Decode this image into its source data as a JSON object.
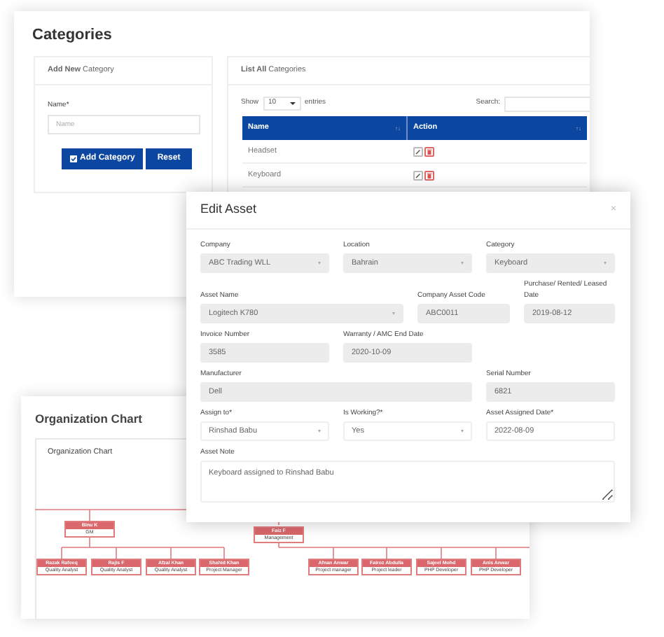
{
  "categories_window": {
    "title": "Categories",
    "add_panel": {
      "heading": "**Add New** Category",
      "name_label": "Name*",
      "name_placeholder": "Name",
      "buttons": [
        "Add Category",
        "Reset"
      ]
    },
    "list_panel": {
      "heading": "**List All** Categories",
      "show_label": "Show",
      "page_size": "10",
      "entries_label": "entries",
      "search_label": "Search:",
      "columns": [
        {
          "label": "Name",
          "sort_icon": "↑↓"
        },
        {
          "label": "Action",
          "sort_icon": "↑↓"
        }
      ],
      "rows": [
        {
          "name": "Headset"
        },
        {
          "name": "Keyboard"
        }
      ]
    }
  },
  "org_window": {
    "title": "Organization Chart",
    "panel_heading": "Organization Chart",
    "nodes": [
      {
        "name": "Binu K",
        "role": "GM",
        "children": [
          {
            "name": "Razak Rafeeq",
            "role": "Quality Analyst"
          },
          {
            "name": "Rajis F",
            "role": "Quality Analyst"
          },
          {
            "name": "Afzal Khan",
            "role": "Quality Analyst"
          },
          {
            "name": "Shahid Khan",
            "role": "Project Manager"
          }
        ]
      },
      {
        "name": "Faiz F",
        "role": "Management",
        "children": [
          {
            "name": "Afnan Anwar",
            "role": "Project manager"
          },
          {
            "name": "Fairoz Abdulla",
            "role": "Project leader"
          },
          {
            "name": "Sajeel Mohd",
            "role": "PHP Developer"
          },
          {
            "name": "Anis Anwar",
            "role": "PHP Developer"
          }
        ]
      }
    ]
  },
  "edit_asset": {
    "title": "Edit Asset",
    "close": "×",
    "rows": [
      [
        {
          "label": "Company",
          "value": "ABC Trading WLL",
          "kind": "select",
          "disabled": true
        },
        {
          "label": "Location",
          "value": "Bahrain",
          "kind": "select",
          "disabled": true
        },
        {
          "label": "Category",
          "value": "Keyboard",
          "kind": "select",
          "disabled": true
        }
      ],
      [
        {
          "label": "Asset Name",
          "value": "Logitech K780",
          "kind": "select",
          "disabled": true
        },
        {
          "label": "Company Asset Code",
          "value": "ABC0011",
          "kind": "text",
          "disabled": true
        },
        {
          "label": "Purchase/ Rented/ Leased Date",
          "value": "2019-08-12",
          "kind": "text",
          "disabled": true
        }
      ],
      [
        {
          "label": "Invoice Number",
          "value": "3585",
          "kind": "text",
          "disabled": true
        },
        {
          "label": "Warranty / AMC End Date",
          "value": "2020-10-09",
          "kind": "text",
          "disabled": true
        }
      ],
      [
        {
          "label": "Manufacturer",
          "value": "Dell",
          "kind": "text",
          "disabled": true
        },
        "",
        {
          "label": "Serial Number",
          "value": "6821",
          "kind": "text",
          "disabled": true
        }
      ],
      [
        {
          "label": "Assign to*",
          "value": "Rinshad Babu",
          "kind": "select",
          "disabled": false
        },
        {
          "label": "Is Working?*",
          "value": "Yes",
          "kind": "select",
          "disabled": false
        },
        {
          "label": "Asset Assigned Date*",
          "value": "2022-08-09",
          "kind": "text",
          "disabled": false
        }
      ],
      [
        {
          "label": "Asset Note",
          "value": "Keyboard assigned to Rinshad Babu",
          "kind": "textarea",
          "disabled": false
        }
      ]
    ]
  }
}
